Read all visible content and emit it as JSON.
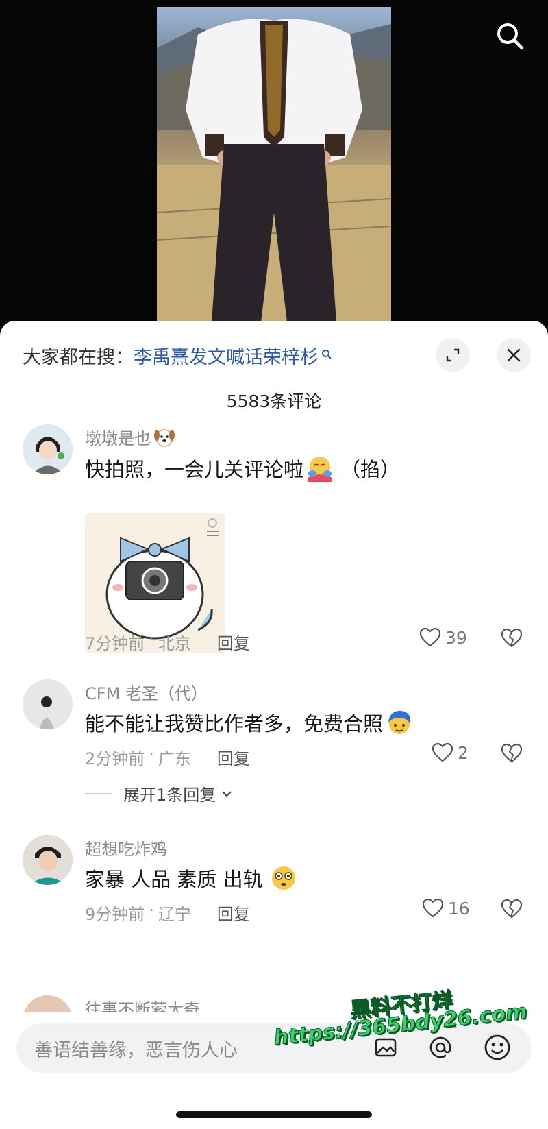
{
  "trending": {
    "prefix": "大家都在搜：",
    "term": "李禹熹发文喊话荣梓杉"
  },
  "comment_count": "5583条评论",
  "comments": [
    {
      "username": "墩墩是也",
      "username_emoji": "dog-face",
      "text": "快拍照，一会儿关评论啦",
      "text_emoji": "hugging-face",
      "text_suffix": "（掐）",
      "sticker": "cat-with-camera-sticker",
      "time": "7分钟前",
      "location": "北京",
      "reply_label": "回复",
      "likes": "39"
    },
    {
      "username": "CFM 老圣（代）",
      "text": "能不能让我赞比作者多，免费合照",
      "text_emoji": "blue-hair-face",
      "time": "2分钟前",
      "location": "广东",
      "reply_label": "回复",
      "likes": "2",
      "expand_replies": "展开1条回复"
    },
    {
      "username": "超想吃炸鸡",
      "text": "家暴 人品 素质 出轨",
      "text_emoji": "flushed-face",
      "time": "9分钟前",
      "location": "辽宁",
      "reply_label": "回复",
      "likes": "16"
    },
    {
      "username": "往事不断萦大奇"
    }
  ],
  "input": {
    "placeholder": "善语结善缘，恶言伤人心"
  },
  "watermark": {
    "line1": "黑料不打烊",
    "line2": "https://365bdy26.com"
  },
  "colors": {
    "link": "#2c5aa0",
    "text": "#161616",
    "meta": "#9b9b9b",
    "sheet": "#ffffff",
    "watermark": "#39d36b"
  }
}
